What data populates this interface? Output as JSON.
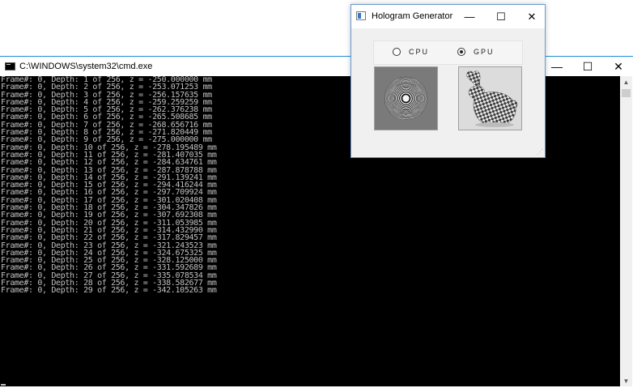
{
  "cmd": {
    "title": "C:\\WINDOWS\\system32\\cmd.exe",
    "minimize_glyph": "—",
    "maximize_glyph": "☐",
    "close_glyph": "✕",
    "lines": [
      "Frame#: 0, Depth: 1 of 256, z = -250.000000 mm",
      "Frame#: 0, Depth: 2 of 256, z = -253.071253 mm",
      "Frame#: 0, Depth: 3 of 256, z = -256.157635 mm",
      "Frame#: 0, Depth: 4 of 256, z = -259.259259 mm",
      "Frame#: 0, Depth: 5 of 256, z = -262.376238 mm",
      "Frame#: 0, Depth: 6 of 256, z = -265.508685 mm",
      "Frame#: 0, Depth: 7 of 256, z = -268.656716 mm",
      "Frame#: 0, Depth: 8 of 256, z = -271.820449 mm",
      "Frame#: 0, Depth: 9 of 256, z = -275.000000 mm",
      "Frame#: 0, Depth: 10 of 256, z = -278.195489 mm",
      "Frame#: 0, Depth: 11 of 256, z = -281.407035 mm",
      "Frame#: 0, Depth: 12 of 256, z = -284.634761 mm",
      "Frame#: 0, Depth: 13 of 256, z = -287.878788 mm",
      "Frame#: 0, Depth: 14 of 256, z = -291.139241 mm",
      "Frame#: 0, Depth: 15 of 256, z = -294.416244 mm",
      "Frame#: 0, Depth: 16 of 256, z = -297.709924 mm",
      "Frame#: 0, Depth: 17 of 256, z = -301.020408 mm",
      "Frame#: 0, Depth: 18 of 256, z = -304.347826 mm",
      "Frame#: 0, Depth: 19 of 256, z = -307.692308 mm",
      "Frame#: 0, Depth: 20 of 256, z = -311.053985 mm",
      "Frame#: 0, Depth: 21 of 256, z = -314.432990 mm",
      "Frame#: 0, Depth: 22 of 256, z = -317.829457 mm",
      "Frame#: 0, Depth: 23 of 256, z = -321.243523 mm",
      "Frame#: 0, Depth: 24 of 256, z = -324.675325 mm",
      "Frame#: 0, Depth: 25 of 256, z = -328.125000 mm",
      "Frame#: 0, Depth: 26 of 256, z = -331.592689 mm",
      "Frame#: 0, Depth: 27 of 256, z = -335.078534 mm",
      "Frame#: 0, Depth: 28 of 256, z = -338.582677 mm",
      "Frame#: 0, Depth: 29 of 256, z = -342.105263 mm"
    ],
    "scroll_up_glyph": "▲",
    "scroll_down_glyph": "▼"
  },
  "hologram": {
    "title": "Hologram Generator",
    "minimize_glyph": "—",
    "maximize_glyph": "☐",
    "close_glyph": "✕",
    "radios": [
      {
        "label": "CPU",
        "checked": false
      },
      {
        "label": "GPU",
        "checked": true
      }
    ],
    "images": {
      "cpu": "fresnel-zone-pattern",
      "gpu": "checkered-bunny-render"
    }
  },
  "colors": {
    "console_bg": "#000000",
    "console_text": "#c0c0c0",
    "window_border": "#1c8fd6"
  }
}
